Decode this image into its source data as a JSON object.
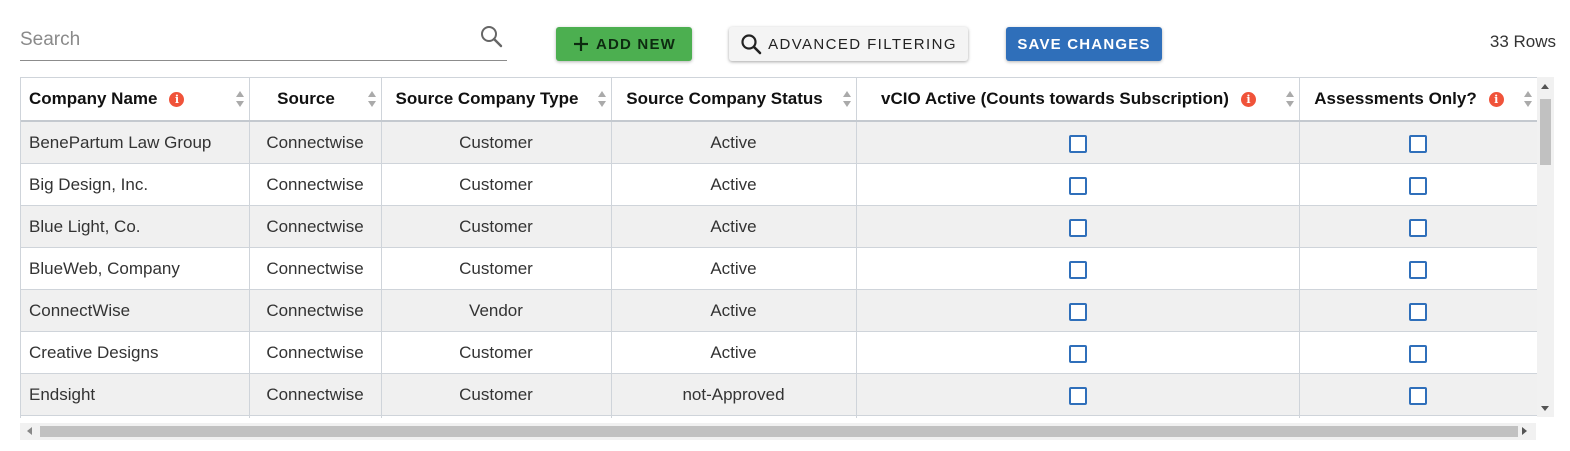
{
  "search": {
    "placeholder": "Search",
    "value": ""
  },
  "toolbar": {
    "add_label": "ADD NEW",
    "filter_label": "ADVANCED FILTERING",
    "save_label": "SAVE CHANGES",
    "row_count": "33 Rows"
  },
  "colors": {
    "add": "#4caf50",
    "save": "#2f6fba",
    "info": "#f0533a",
    "checkbox": "#2f6fba"
  },
  "columns": [
    "Company Name",
    "Source",
    "Source Company Type",
    "Source Company Status",
    "vCIO Active (Counts towards Subscription)",
    "Assessments Only?"
  ],
  "rows": [
    {
      "name": "BenePartum Law Group",
      "source": "Connectwise",
      "type": "Customer",
      "status": "Active",
      "vcio": false,
      "assess": false
    },
    {
      "name": "Big Design, Inc.",
      "source": "Connectwise",
      "type": "Customer",
      "status": "Active",
      "vcio": false,
      "assess": false
    },
    {
      "name": "Blue Light, Co.",
      "source": "Connectwise",
      "type": "Customer",
      "status": "Active",
      "vcio": false,
      "assess": false
    },
    {
      "name": "BlueWeb, Company",
      "source": "Connectwise",
      "type": "Customer",
      "status": "Active",
      "vcio": false,
      "assess": false
    },
    {
      "name": "ConnectWise",
      "source": "Connectwise",
      "type": "Vendor",
      "status": "Active",
      "vcio": false,
      "assess": false
    },
    {
      "name": "Creative Designs",
      "source": "Connectwise",
      "type": "Customer",
      "status": "Active",
      "vcio": false,
      "assess": false
    },
    {
      "name": "Endsight",
      "source": "Connectwise",
      "type": "Customer",
      "status": "not-Approved",
      "vcio": false,
      "assess": false
    }
  ],
  "icons": {
    "search": "search-icon",
    "add": "plus-icon",
    "filter": "magnifier-icon",
    "info": "info-icon",
    "sort": "sort-icon"
  }
}
